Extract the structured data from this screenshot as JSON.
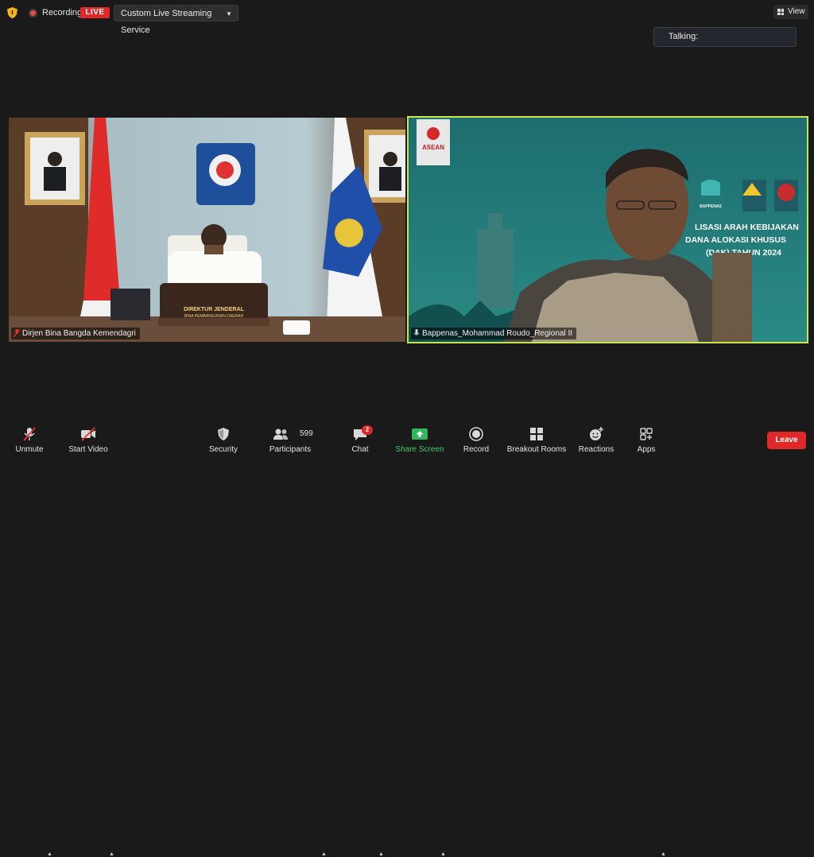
{
  "topbar": {
    "recording_label": "Recording",
    "live_badge": "LIVE",
    "stream_service": "Custom Live Streaming Service",
    "view_label": "View"
  },
  "talking_label": "Talking:",
  "participants_tiles": [
    {
      "name": "Dirjen Bina Bangda Kemendagri",
      "desk_plate_line1": "DIREKTUR JENDERAL",
      "desk_plate_line2": "BINA PEMBANGUNAN DAERAH"
    },
    {
      "name": "Bappenas_Mohammad Roudo_Regional II",
      "asean_label": "ASEAN",
      "bappenas_label": "BAPPENAS",
      "banner_line1": "LISASI ARAH KEBIJAKAN",
      "banner_line2": "DANA ALOKASI KHUSUS",
      "banner_line3": "(DAK) TAHUN 2024"
    }
  ],
  "toolbar": {
    "unmute": "Unmute",
    "start_video": "Start Video",
    "security": "Security",
    "participants": "Participants",
    "participants_count": "599",
    "chat": "Chat",
    "chat_badge": "2",
    "share_screen": "Share Screen",
    "record": "Record",
    "breakout_rooms": "Breakout Rooms",
    "reactions": "Reactions",
    "apps": "Apps",
    "leave": "Leave"
  },
  "colors": {
    "accent_green": "#4ac96a",
    "live_red": "#e02828",
    "active_speaker_border": "#c7e64a"
  }
}
